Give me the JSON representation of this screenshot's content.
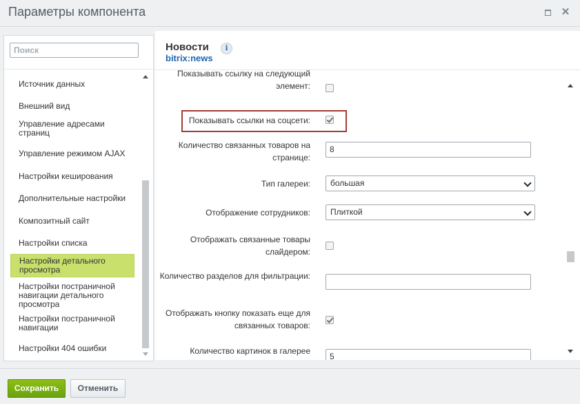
{
  "window": {
    "title": "Параметры компонента"
  },
  "search": {
    "placeholder": "Поиск"
  },
  "sidebar": {
    "items": [
      {
        "label": "Источник данных",
        "active": false
      },
      {
        "label": "Внешний вид",
        "active": false
      },
      {
        "label": "Управление адресами страниц",
        "active": false
      },
      {
        "label": "Управление режимом AJAX",
        "active": false
      },
      {
        "label": "Настройки кеширования",
        "active": false
      },
      {
        "label": "Дополнительные настройки",
        "active": false
      },
      {
        "label": "Композитный сайт",
        "active": false
      },
      {
        "label": "Настройки списка",
        "active": false
      },
      {
        "label": "Настройки детального просмотра",
        "active": true
      },
      {
        "label": "Настройки постраничной навигации детального просмотра",
        "active": false
      },
      {
        "label": "Настройки постраничной навигации",
        "active": false
      },
      {
        "label": "Настройки 404 ошибки",
        "active": false
      }
    ]
  },
  "component": {
    "title": "Новости",
    "code": "bitrix:news",
    "info_icon": "info-icon"
  },
  "params": [
    {
      "label": "Показывать ссылку на следующий элемент:",
      "type": "checkbox",
      "checked": false
    },
    {
      "label": "Показывать ссылки на соцсети:",
      "type": "checkbox",
      "checked": true,
      "highlighted": true
    },
    {
      "label": "Количество связанных товаров на странице:",
      "type": "text",
      "value": "8"
    },
    {
      "label": "Тип галереи:",
      "type": "select",
      "value": "большая"
    },
    {
      "label": "Отображение сотрудников:",
      "type": "select",
      "value": "Плиткой"
    },
    {
      "label": "Отображать связанные товары слайдером:",
      "type": "checkbox",
      "checked": false
    },
    {
      "label": "Количество разделов для фильтрации:",
      "type": "text",
      "value": ""
    },
    {
      "label": "Отображать кнопку показать еще для связанных товаров:",
      "type": "checkbox",
      "checked": true
    },
    {
      "label": "Количество картинок в галерее",
      "type": "text",
      "value": "5"
    }
  ],
  "footer": {
    "save_label": "Сохранить",
    "cancel_label": "Отменить"
  },
  "colors": {
    "accent_green": "#7ab30f",
    "active_item": "#c9e06d",
    "link_blue": "#2067b0",
    "highlight_border": "#a33a32"
  }
}
